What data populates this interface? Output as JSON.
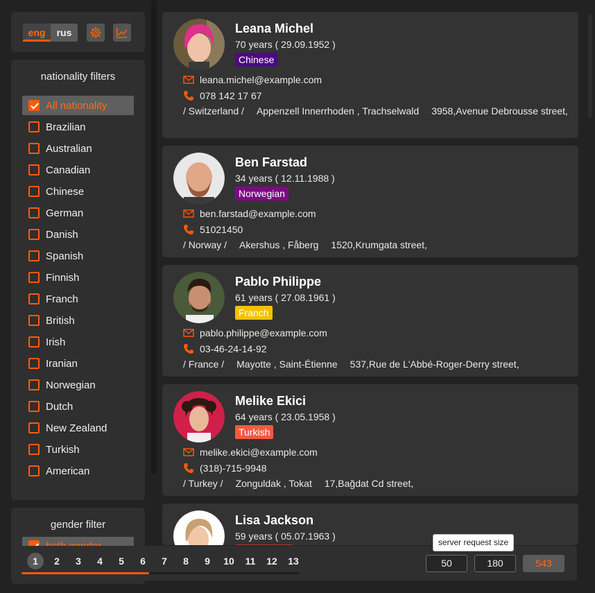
{
  "language": {
    "eng": "eng",
    "rus": "rus",
    "active": "eng"
  },
  "nationality_filters": {
    "title": "nationality filters",
    "items": [
      {
        "label": "All nationality",
        "checked": true
      },
      {
        "label": "Brazilian",
        "checked": false
      },
      {
        "label": "Australian",
        "checked": false
      },
      {
        "label": "Canadian",
        "checked": false
      },
      {
        "label": "Chinese",
        "checked": false
      },
      {
        "label": "German",
        "checked": false
      },
      {
        "label": "Danish",
        "checked": false
      },
      {
        "label": "Spanish",
        "checked": false
      },
      {
        "label": "Finnish",
        "checked": false
      },
      {
        "label": "Franch",
        "checked": false
      },
      {
        "label": "British",
        "checked": false
      },
      {
        "label": "Irish",
        "checked": false
      },
      {
        "label": "Iranian",
        "checked": false
      },
      {
        "label": "Norwegian",
        "checked": false
      },
      {
        "label": "Dutch",
        "checked": false
      },
      {
        "label": "New Zealand",
        "checked": false
      },
      {
        "label": "Turkish",
        "checked": false
      },
      {
        "label": "American",
        "checked": false
      }
    ]
  },
  "gender_filter": {
    "title": "gender filter",
    "selected": "both gender"
  },
  "users": [
    {
      "name": "Leana Michel",
      "age": "70 years ( 29.09.1952 )",
      "nationality": "Chinese",
      "badge_color": "#4b0a82",
      "email": "leana.michel@example.com",
      "phone": "078 142 17 67",
      "country": "/ Switzerland /",
      "region": "Appenzell Innerrhoden , Trachselwald",
      "street": "3958,Avenue Debrousse street,"
    },
    {
      "name": "Ben Farstad",
      "age": "34 years ( 12.11.1988 )",
      "nationality": "Norwegian",
      "badge_color": "#7d0a82",
      "email": "ben.farstad@example.com",
      "phone": "51021450",
      "country": "/ Norway /",
      "region": "Akershus , Fåberg",
      "street": "1520,Krumgata street,"
    },
    {
      "name": "Pablo Philippe",
      "age": "61 years ( 27.08.1961 )",
      "nationality": "Franch",
      "badge_color": "#f2c200",
      "email": "pablo.philippe@example.com",
      "phone": "03-46-24-14-92",
      "country": "/ France /",
      "region": "Mayotte , Saint-Étienne",
      "street": "537,Rue de L'Abbé-Roger-Derry street,"
    },
    {
      "name": "Melike Ekici",
      "age": "64 years ( 23.05.1958 )",
      "nationality": "Turkish",
      "badge_color": "#f25a42",
      "email": "melike.ekici@example.com",
      "phone": "(318)-715-9948",
      "country": "/ Turkey /",
      "region": "Zonguldak , Tokat",
      "street": "17,Bağdat Cd street,"
    },
    {
      "name": "Lisa Jackson",
      "age": "59 years ( 05.07.1963 )",
      "nationality": "",
      "badge_color": "#c0342a",
      "email": "",
      "phone": "",
      "country": "",
      "region": "",
      "street": ""
    }
  ],
  "pagination": {
    "pages": [
      "1",
      "2",
      "3",
      "4",
      "5",
      "6",
      "7",
      "8",
      "9",
      "10",
      "11",
      "12",
      "13"
    ],
    "active": "1"
  },
  "request_size": {
    "tooltip": "server request size",
    "options": [
      "50",
      "180",
      "543"
    ],
    "active": "543"
  },
  "colors": {
    "accent": "#ff5a0a",
    "card": "#333333",
    "panel": "#2f2f2f",
    "background": "#222222"
  },
  "icons": {
    "settings": "gear-icon",
    "stats": "chart-icon",
    "email": "envelope-icon",
    "phone": "phone-icon"
  }
}
